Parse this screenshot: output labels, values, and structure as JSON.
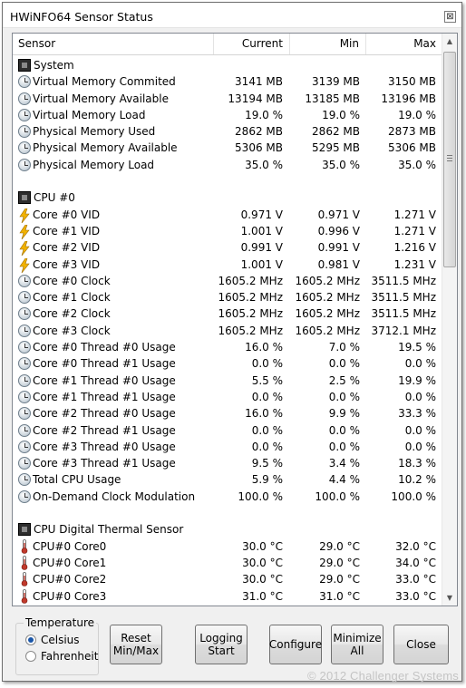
{
  "window": {
    "title": "HWiNFO64 Sensor Status",
    "close_glyph": "⊠"
  },
  "columns": {
    "sensor": "Sensor",
    "current": "Current",
    "min": "Min",
    "max": "Max"
  },
  "rows": [
    {
      "type": "group",
      "icon": "chip-icon",
      "name": "System"
    },
    {
      "type": "item",
      "icon": "clock-icon",
      "name": "Virtual Memory Commited",
      "current": "3141 MB",
      "min": "3139 MB",
      "max": "3150 MB"
    },
    {
      "type": "item",
      "icon": "clock-icon",
      "name": "Virtual Memory Available",
      "current": "13194 MB",
      "min": "13185 MB",
      "max": "13196 MB"
    },
    {
      "type": "item",
      "icon": "clock-icon",
      "name": "Virtual Memory Load",
      "current": "19.0 %",
      "min": "19.0 %",
      "max": "19.0 %"
    },
    {
      "type": "item",
      "icon": "clock-icon",
      "name": "Physical Memory Used",
      "current": "2862 MB",
      "min": "2862 MB",
      "max": "2873 MB"
    },
    {
      "type": "item",
      "icon": "clock-icon",
      "name": "Physical Memory Available",
      "current": "5306 MB",
      "min": "5295 MB",
      "max": "5306 MB"
    },
    {
      "type": "item",
      "icon": "clock-icon",
      "name": "Physical Memory Load",
      "current": "35.0 %",
      "min": "35.0 %",
      "max": "35.0 %"
    },
    {
      "type": "blank"
    },
    {
      "type": "group",
      "icon": "chip-icon",
      "name": "CPU #0"
    },
    {
      "type": "item",
      "icon": "bolt-icon",
      "name": "Core #0 VID",
      "current": "0.971 V",
      "min": "0.971 V",
      "max": "1.271 V"
    },
    {
      "type": "item",
      "icon": "bolt-icon",
      "name": "Core #1 VID",
      "current": "1.001 V",
      "min": "0.996 V",
      "max": "1.271 V"
    },
    {
      "type": "item",
      "icon": "bolt-icon",
      "name": "Core #2 VID",
      "current": "0.991 V",
      "min": "0.991 V",
      "max": "1.216 V"
    },
    {
      "type": "item",
      "icon": "bolt-icon",
      "name": "Core #3 VID",
      "current": "1.001 V",
      "min": "0.981 V",
      "max": "1.231 V"
    },
    {
      "type": "item",
      "icon": "clock-icon",
      "name": "Core #0 Clock",
      "current": "1605.2 MHz",
      "min": "1605.2 MHz",
      "max": "3511.5 MHz"
    },
    {
      "type": "item",
      "icon": "clock-icon",
      "name": "Core #1 Clock",
      "current": "1605.2 MHz",
      "min": "1605.2 MHz",
      "max": "3511.5 MHz"
    },
    {
      "type": "item",
      "icon": "clock-icon",
      "name": "Core #2 Clock",
      "current": "1605.2 MHz",
      "min": "1605.2 MHz",
      "max": "3511.5 MHz"
    },
    {
      "type": "item",
      "icon": "clock-icon",
      "name": "Core #3 Clock",
      "current": "1605.2 MHz",
      "min": "1605.2 MHz",
      "max": "3712.1 MHz"
    },
    {
      "type": "item",
      "icon": "clock-icon",
      "name": "Core #0 Thread #0 Usage",
      "current": "16.0 %",
      "min": "7.0 %",
      "max": "19.5 %"
    },
    {
      "type": "item",
      "icon": "clock-icon",
      "name": "Core #0 Thread #1 Usage",
      "current": "0.0 %",
      "min": "0.0 %",
      "max": "0.0 %"
    },
    {
      "type": "item",
      "icon": "clock-icon",
      "name": "Core #1 Thread #0 Usage",
      "current": "5.5 %",
      "min": "2.5 %",
      "max": "19.9 %"
    },
    {
      "type": "item",
      "icon": "clock-icon",
      "name": "Core #1 Thread #1 Usage",
      "current": "0.0 %",
      "min": "0.0 %",
      "max": "0.0 %"
    },
    {
      "type": "item",
      "icon": "clock-icon",
      "name": "Core #2 Thread #0 Usage",
      "current": "16.0 %",
      "min": "9.9 %",
      "max": "33.3 %"
    },
    {
      "type": "item",
      "icon": "clock-icon",
      "name": "Core #2 Thread #1 Usage",
      "current": "0.0 %",
      "min": "0.0 %",
      "max": "0.0 %"
    },
    {
      "type": "item",
      "icon": "clock-icon",
      "name": "Core #3 Thread #0 Usage",
      "current": "0.0 %",
      "min": "0.0 %",
      "max": "0.0 %"
    },
    {
      "type": "item",
      "icon": "clock-icon",
      "name": "Core #3 Thread #1 Usage",
      "current": "9.5 %",
      "min": "3.4 %",
      "max": "18.3 %"
    },
    {
      "type": "item",
      "icon": "clock-icon",
      "name": "Total CPU Usage",
      "current": "5.9 %",
      "min": "4.4 %",
      "max": "10.2 %"
    },
    {
      "type": "item",
      "icon": "clock-icon",
      "name": "On-Demand Clock Modulation",
      "current": "100.0 %",
      "min": "100.0 %",
      "max": "100.0 %"
    },
    {
      "type": "blank"
    },
    {
      "type": "group",
      "icon": "chip-icon",
      "name": "CPU Digital Thermal Sensor"
    },
    {
      "type": "item",
      "icon": "thermometer-icon",
      "name": "CPU#0 Core0",
      "current": "30.0 °C",
      "min": "29.0 °C",
      "max": "32.0 °C"
    },
    {
      "type": "item",
      "icon": "thermometer-icon",
      "name": "CPU#0 Core1",
      "current": "30.0 °C",
      "min": "29.0 °C",
      "max": "34.0 °C"
    },
    {
      "type": "item",
      "icon": "thermometer-icon",
      "name": "CPU#0 Core2",
      "current": "30.0 °C",
      "min": "29.0 °C",
      "max": "33.0 °C"
    },
    {
      "type": "item",
      "icon": "thermometer-icon",
      "name": "CPU#0 Core3",
      "current": "31.0 °C",
      "min": "31.0 °C",
      "max": "33.0 °C"
    }
  ],
  "scrollbar": {
    "up_glyph": "▲",
    "down_glyph": "▼"
  },
  "temperature": {
    "legend": "Temperature",
    "options": [
      {
        "label": "Celsius",
        "selected": true
      },
      {
        "label": "Fahrenheit",
        "selected": false
      }
    ]
  },
  "buttons": {
    "reset": [
      "Reset",
      "Min/Max"
    ],
    "logging": [
      "Logging",
      "Start"
    ],
    "configure": "Configure",
    "minimize": [
      "Minimize",
      "All"
    ],
    "close": "Close"
  },
  "watermark": "© 2012 Challenger Systems",
  "colors": {
    "radio_selected": "#1a56a8",
    "bolt": "#f2b200",
    "thermometer": "#c0392b"
  }
}
